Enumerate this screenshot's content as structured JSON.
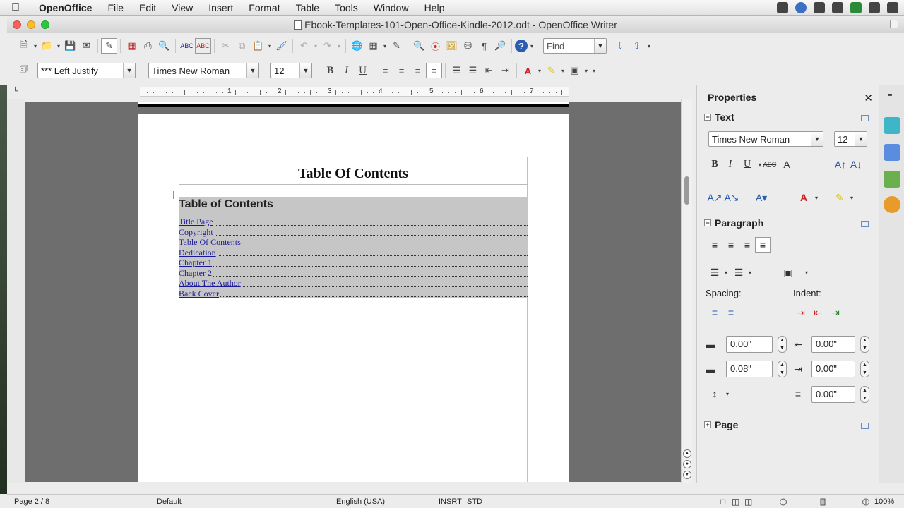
{
  "menubar": {
    "app": "OpenOffice",
    "items": [
      "File",
      "Edit",
      "View",
      "Insert",
      "Format",
      "Table",
      "Tools",
      "Window",
      "Help"
    ]
  },
  "window": {
    "title": "Ebook-Templates-101-Open-Office-Kindle-2012.odt - OpenOffice Writer"
  },
  "toolbar": {
    "find_placeholder": "Find"
  },
  "formatting": {
    "paragraph_style": "*** Left Justify",
    "font_name": "Times New Roman",
    "font_size": "12",
    "bold": "B",
    "italic": "I",
    "underline": "U"
  },
  "ruler": {
    "numbers": [
      "1",
      "2",
      "3",
      "4",
      "5",
      "6",
      "7"
    ]
  },
  "document": {
    "header_title": "Table Of Contents",
    "toc_heading": "Table of Contents",
    "toc_entries": [
      "Title Page",
      "Copyright",
      "Table Of Contents",
      "Dedication",
      "Chapter 1",
      "Chapter 2",
      "About The Author",
      "Back Cover"
    ]
  },
  "sidebar": {
    "title": "Properties",
    "text_section": {
      "label": "Text",
      "font_name": "Times New Roman",
      "font_size": "12"
    },
    "paragraph_section": {
      "label": "Paragraph",
      "spacing_label": "Spacing:",
      "indent_label": "Indent:",
      "above_spacing": "0.00\"",
      "below_spacing": "0.08\"",
      "before_indent": "0.00\"",
      "after_indent": "0.00\"",
      "first_line_indent": "0.00\""
    },
    "page_section": {
      "label": "Page"
    }
  },
  "statusbar": {
    "page": "Page 2 / 8",
    "style": "Default",
    "language": "English (USA)",
    "insert_mode": "INSRT",
    "selection_mode": "STD",
    "zoom": "100%"
  },
  "colors": {
    "accent": "#1a1a9a",
    "selection": "#c6c6c6",
    "close_red": "#fc5f57",
    "minimize_yellow": "#fdbc2e",
    "zoom_green": "#2ac840"
  }
}
